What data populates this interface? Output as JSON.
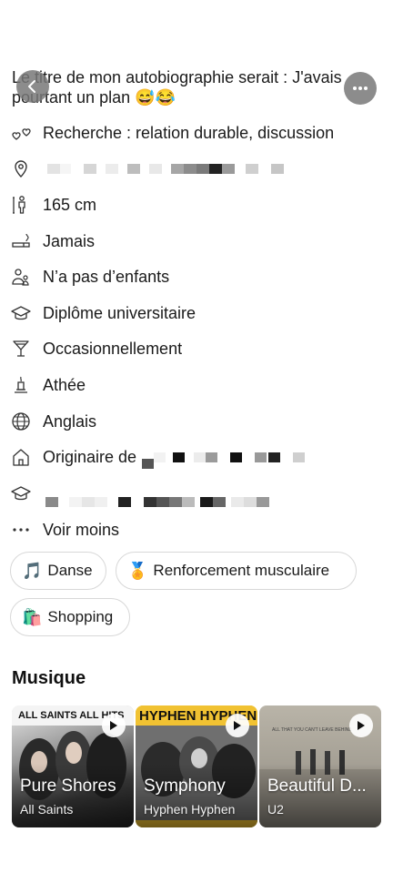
{
  "header": {
    "bio": "Le titre de mon autobiographie serait : J'avais pourtant un plan 😅😂"
  },
  "details": [
    {
      "icon": "hearts-icon",
      "label": "Recherche : relation durable, discussion"
    },
    {
      "icon": "location-pin-icon",
      "label": ""
    },
    {
      "icon": "height-icon",
      "label": "165 cm"
    },
    {
      "icon": "cigarette-icon",
      "label": "Jamais"
    },
    {
      "icon": "children-icon",
      "label": "N’a pas d’enfants"
    },
    {
      "icon": "graduation-cap-icon",
      "label": "Diplôme universitaire"
    },
    {
      "icon": "cocktail-glass-icon",
      "label": "Occasionnellement"
    },
    {
      "icon": "candle-icon",
      "label": "Athée"
    },
    {
      "icon": "globe-icon",
      "label": "Anglais"
    },
    {
      "icon": "house-icon",
      "label": "Originaire de"
    },
    {
      "icon": "graduation-cap-icon",
      "label": ""
    },
    {
      "icon": "ellipsis-icon",
      "label": "Voir moins"
    }
  ],
  "interests": [
    {
      "emoji": "🎵",
      "label": "Danse"
    },
    {
      "emoji": "🏅",
      "label": "Renforcement musculaire"
    },
    {
      "emoji": "🛍️",
      "label": "Shopping"
    }
  ],
  "music": {
    "title": "Musique",
    "albums": [
      {
        "song": "Pure Shores",
        "artist": "All Saints",
        "cover_text": "ALL SAINTS ALL HITS"
      },
      {
        "song": "Symphony",
        "artist": "Hyphen Hyphen",
        "cover_text": "HYPHEN HYPHEN"
      },
      {
        "song": "Beautiful D...",
        "artist": "U2",
        "cover_text": "ALL THAT YOU CAN'T LEAVE BEHIND"
      }
    ]
  },
  "colors": {
    "accent_button": "#7a7a7a",
    "chip_border": "#d8d8d8",
    "text": "#1a1a1a"
  }
}
